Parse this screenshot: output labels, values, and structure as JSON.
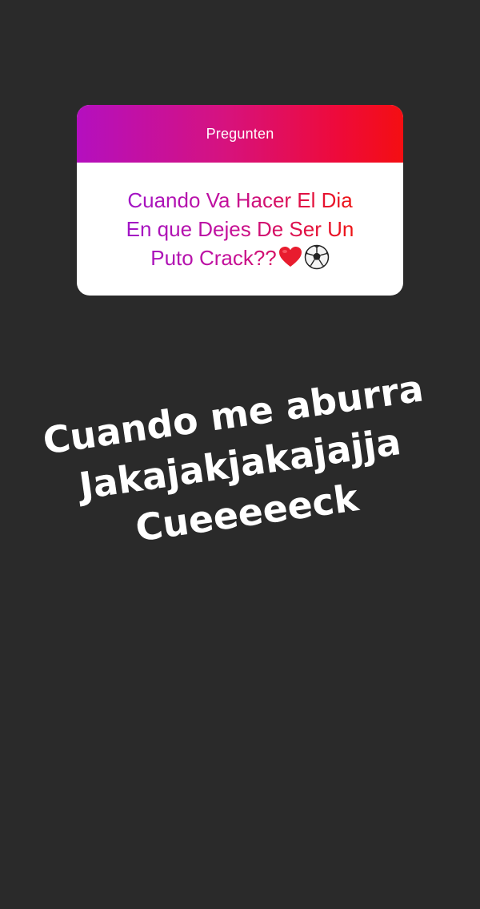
{
  "question_card": {
    "title": "Pregunten",
    "question_lines": [
      "Cuando Va Hacer El Dia",
      "En que Dejes De Ser Un",
      "Puto  Crack??"
    ],
    "emojis": [
      "heart-icon",
      "soccer-ball-icon"
    ]
  },
  "answer": {
    "lines": [
      "Cuando me aburra",
      "Jakajakjakajajja",
      "Cueeeeeck"
    ]
  },
  "colors": {
    "background": "#2a2a2a",
    "header_gradient_start": "#b40fbf",
    "header_gradient_end": "#f40e12",
    "answer_text": "#ffffff"
  }
}
